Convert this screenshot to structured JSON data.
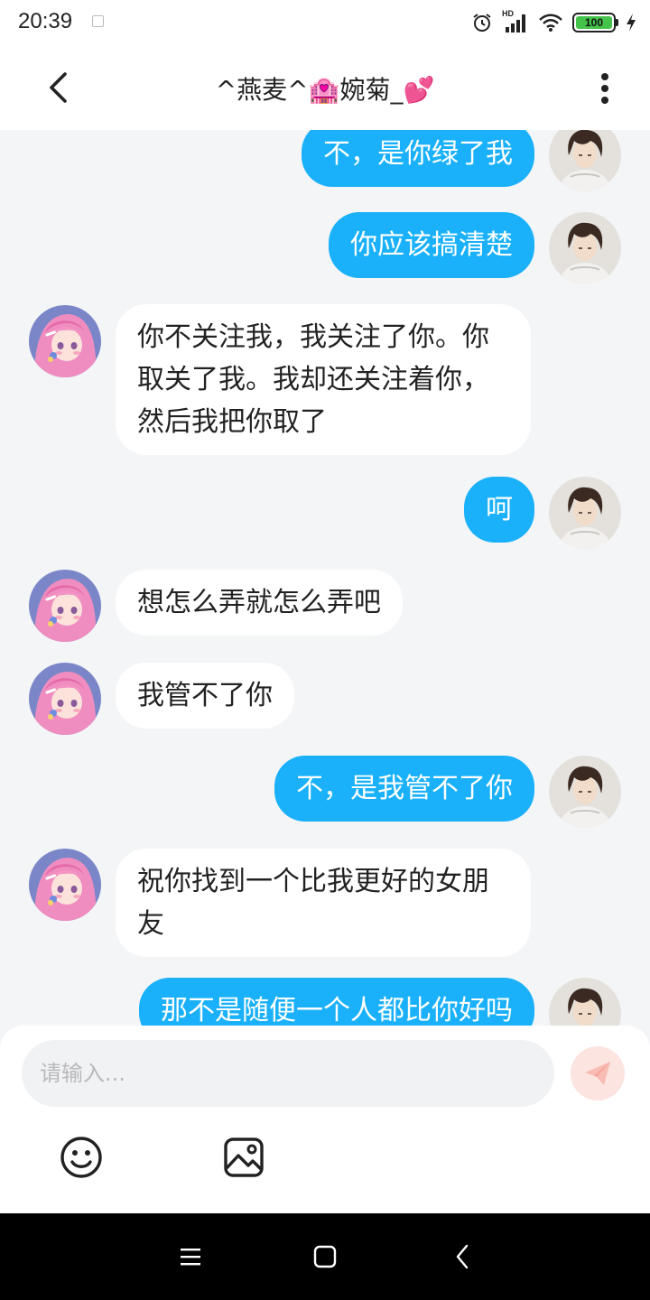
{
  "status_bar": {
    "time": "20:39",
    "network": "HD",
    "battery": "100",
    "battery_color": "#45c24a"
  },
  "header": {
    "title": "^燕麦^🏩婉菊_💕"
  },
  "colors": {
    "outgoing_bubble": "#1ab1fa",
    "incoming_bubble": "#ffffff",
    "background": "#f4f5f7"
  },
  "messages": [
    {
      "from": "me",
      "text": "不，是你绿了我"
    },
    {
      "from": "me",
      "text": "你应该搞清楚"
    },
    {
      "from": "them",
      "line1": "你不关注我，我关注了你。你",
      "line2": "取关了我。我却还关注着你，",
      "line3": "然后我把你取了"
    },
    {
      "from": "me",
      "text": "呵"
    },
    {
      "from": "them",
      "text": "想怎么弄就怎么弄吧"
    },
    {
      "from": "them",
      "text": "我管不了你"
    },
    {
      "from": "me",
      "text": "不，是我管不了你"
    },
    {
      "from": "them",
      "line1": "祝你找到一个比我更好的女朋",
      "line2": "友"
    },
    {
      "from": "me",
      "text": "那不是随便一个人都比你好吗"
    }
  ],
  "composer": {
    "placeholder": "请输入..."
  },
  "icons": {
    "back": "chevron-left-icon",
    "more": "more-vertical-icon",
    "send": "paper-plane-icon",
    "emoji": "smiley-icon",
    "image": "image-icon",
    "alarm": "alarm-clock-icon",
    "signal": "signal-icon",
    "wifi": "wifi-icon",
    "charging": "lightning-icon"
  }
}
